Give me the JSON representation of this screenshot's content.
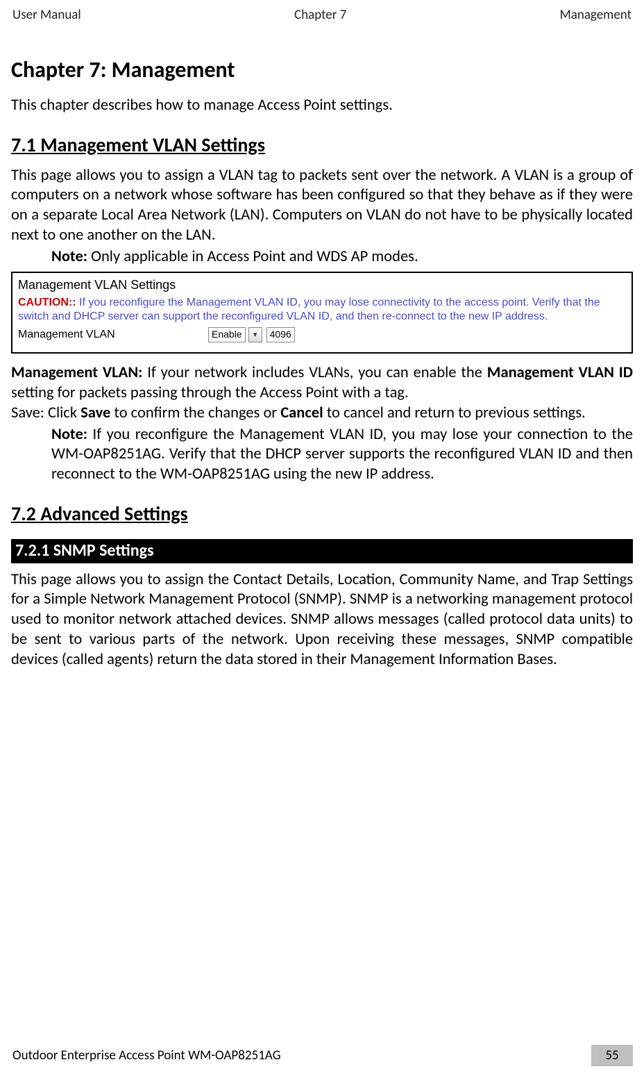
{
  "header": {
    "left": "User Manual",
    "center": "Chapter 7",
    "right": "Management"
  },
  "h1": "Chapter 7: Management",
  "intro": "This chapter describes how to manage Access Point settings.",
  "s71": {
    "title": "7.1 Management VLAN Settings",
    "para": "This page allows you to assign a VLAN tag to packets sent over the network. A VLAN is a group of computers on a network whose software has been configured so that they behave as if they were on a separate Local Area Network (LAN). Computers on VLAN do not have to be physically located next to one another on the LAN.",
    "note_b": "Note:",
    "note_t": " Only applicable in Access Point and WDS AP modes."
  },
  "screenshot": {
    "title": "Management VLAN Settings",
    "caution_b": "CAUTION::",
    "caution_t": " If you reconfigure the Management VLAN ID, you may lose connectivity to the access point. Verify that the switch and DHCP server can support the reconfigured VLAN ID, and then re-connect to the new IP address.",
    "row_label": "Management VLAN",
    "select_value": "Enable",
    "input_value": "4096"
  },
  "after": {
    "mv_b": "Management VLAN:",
    "mv_t1": " If your network includes VLANs, you can enable the ",
    "mv_b2": "Management VLAN ID",
    "mv_t2": " setting for packets passing through the Access Point with a tag.",
    "save1": "Save: Click ",
    "save_b1": "Save",
    "save2": " to confirm the changes or ",
    "save_b2": "Cancel",
    "save3": " to cancel and return to previous settings.",
    "note2_b": "Note:",
    "note2_t": " If you reconfigure the Management VLAN ID, you may lose your connection to the WM-OAP8251AG. Verify that the DHCP server supports the reconfigured VLAN ID and then reconnect to the WM-OAP8251AG using the new IP address."
  },
  "s72": {
    "title": "7.2 Advanced Settings",
    "sub": "7.2.1 SNMP Settings",
    "para": "This page allows you to assign the Contact Details, Location, Community Name, and Trap Settings for a Simple Network Management Protocol (SNMP). SNMP is a networking management protocol used to monitor network attached devices. SNMP allows messages (called protocol data units) to be sent to various parts of the network. Upon receiving these messages, SNMP compatible devices (called agents) return the data stored in their Management Information Bases."
  },
  "footer": {
    "title": "Outdoor Enterprise Access Point WM-OAP8251AG",
    "page": "55"
  }
}
